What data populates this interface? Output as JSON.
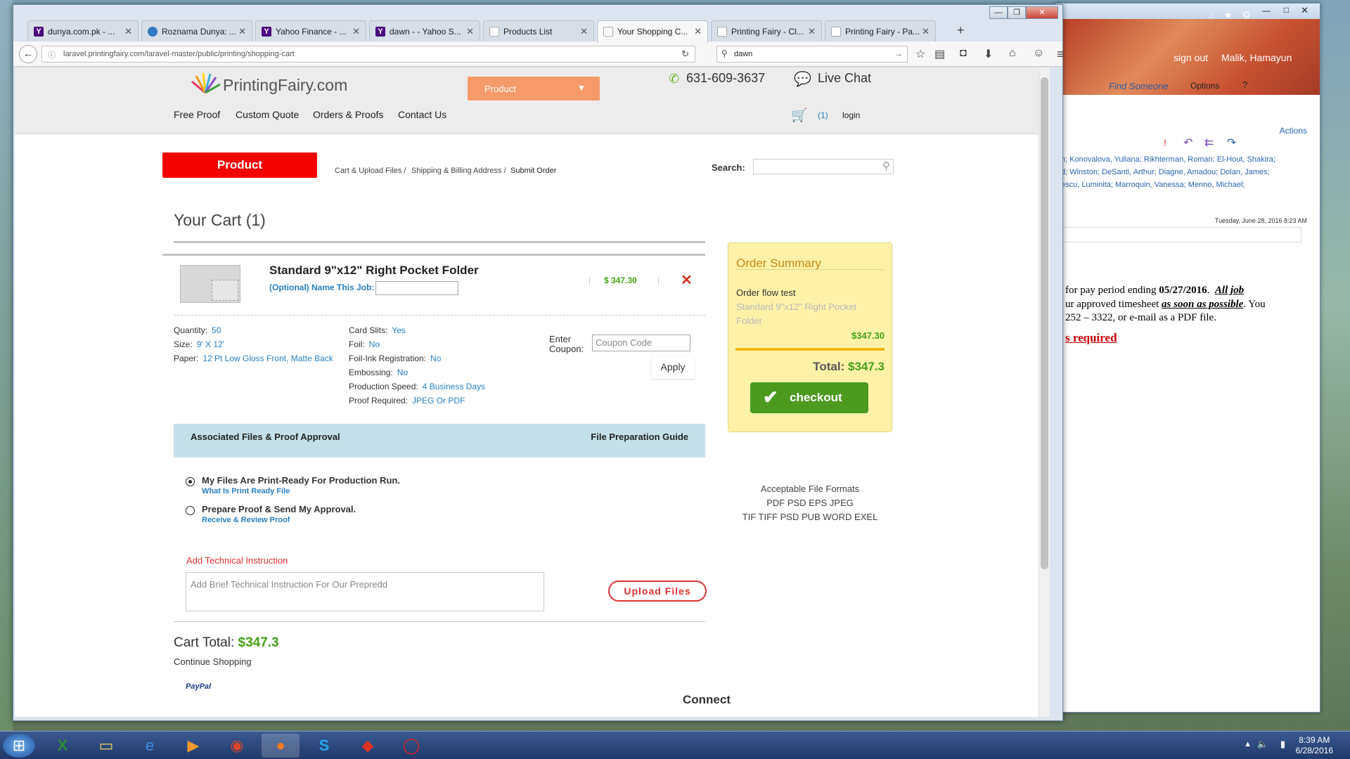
{
  "browser": {
    "tabs": [
      {
        "label": "dunya.com.pk - ...",
        "icon": "yahoo-icon"
      },
      {
        "label": "Roznama Dunya: ...",
        "icon": "globe-icon"
      },
      {
        "label": "Yahoo Finance - ...",
        "icon": "yahoo-icon"
      },
      {
        "label": "dawn - - Yahoo S...",
        "icon": "yahoo-icon"
      },
      {
        "label": "Products List",
        "icon": "page-icon"
      },
      {
        "label": "Your Shopping C...",
        "icon": "page-icon",
        "active": true
      },
      {
        "label": "Printing Fairy - Cl...",
        "icon": "page-icon"
      },
      {
        "label": "Printing Fairy - Pa...",
        "icon": "page-icon"
      }
    ],
    "url": "laravel.printingfairy.com/laravel-master/public/printing/shopping-cart",
    "search_value": "dawn"
  },
  "site": {
    "logo": "PrintingFairy.com",
    "product_dropdown": "Product",
    "phone": "631-609-3637",
    "live_chat": "Live Chat",
    "nav": [
      "Free Proof",
      "Custom Quote",
      "Orders & Proofs",
      "Contact Us"
    ],
    "cart_count": "(1)",
    "login": "login",
    "product_button": "Product",
    "breadcrumb": [
      "Cart & Upload Files /",
      "Shipping & Billing Address /",
      "Submit Order"
    ],
    "search_label": "Search:"
  },
  "cart": {
    "heading": "Your Cart (1)",
    "product_name": "Standard 9\"x12\" Right Pocket Folder",
    "name_job_label": "(Optional) Name This Job:",
    "price": "$ 347.30",
    "specs_left": [
      {
        "k": "Quantity:",
        "v": "50"
      },
      {
        "k": "Size:",
        "v": "9' X 12'"
      },
      {
        "k": "Paper:",
        "v": "12 Pt Low Gloss Front, Matte Back"
      }
    ],
    "specs_mid": [
      {
        "k": "Card Slits:",
        "v": "Yes"
      },
      {
        "k": "Foil:",
        "v": "No"
      },
      {
        "k": "Foil-Ink Registration:",
        "v": "No"
      },
      {
        "k": "Embossing:",
        "v": "No"
      },
      {
        "k": "Production Speed:",
        "v": "4 Business Days"
      },
      {
        "k": "Proof Required:",
        "v": "JPEG Or PDF"
      }
    ],
    "coupon_label_1": "Enter",
    "coupon_label_2": "Coupon:",
    "coupon_placeholder": "Coupon Code",
    "apply": "Apply",
    "assoc_left": "Associated Files & Proof Approval",
    "assoc_right": "File Preparation Guide",
    "option1": "My Files Are Print-Ready For Production Run.",
    "option1_sub": "What Is Print Ready File",
    "option2": "Prepare Proof & Send My Approval.",
    "option2_sub": "Receive & Review Proof",
    "add_tech": "Add Technical Instruction",
    "tech_placeholder": "Add Brief Technical Instruction For Our Prepredd",
    "upload": "Upload Files",
    "cart_total_label": "Cart Total:",
    "cart_total_value": "$347.3",
    "continue": "Continue Shopping",
    "paypal": "PayPal",
    "connect": "Connect"
  },
  "summary": {
    "title": "Order Summary",
    "flow": "Order flow test",
    "item": "Standard 9\"x12\" Right Pocket Folder",
    "item_price": "$347.30",
    "total_label": "Total:",
    "total_value": "$347.3",
    "checkout": "checkout",
    "formats_title": "Acceptable File Formats",
    "formats_1": "PDF PSD EPS JPEG",
    "formats_2": "TIF TIFF PSD PUB WORD EXEL"
  },
  "outlook": {
    "sign_out": "sign out",
    "user": "Malik, Hamayun",
    "find": "Find Someone",
    "options": "Options",
    "actions": "Actions",
    "recipients": [
      "n; Konovalova, Yuliana; Rikhterman, Roman; El-Hout, Shakira;",
      "d; Winston; DeSanti, Arthur; Diagne, Amadou; Dolan, James;",
      "escu, Luminita; Marroquin, Vanessa; Menno, Michael;"
    ],
    "date": "Tuesday, June 28, 2016 8:23 AM",
    "body_1": "for pay period ending",
    "body_date": "05/27/2016",
    "body_alljob": "All job",
    "body_2": "ur approved timesheet",
    "body_asap": "as soon as possible",
    "body_3": ". You",
    "body_4": "252 – 3322, or e-mail as a PDF file.",
    "body_req": "s required"
  },
  "taskbar": {
    "time": "8:39 AM",
    "date": "6/28/2016"
  }
}
